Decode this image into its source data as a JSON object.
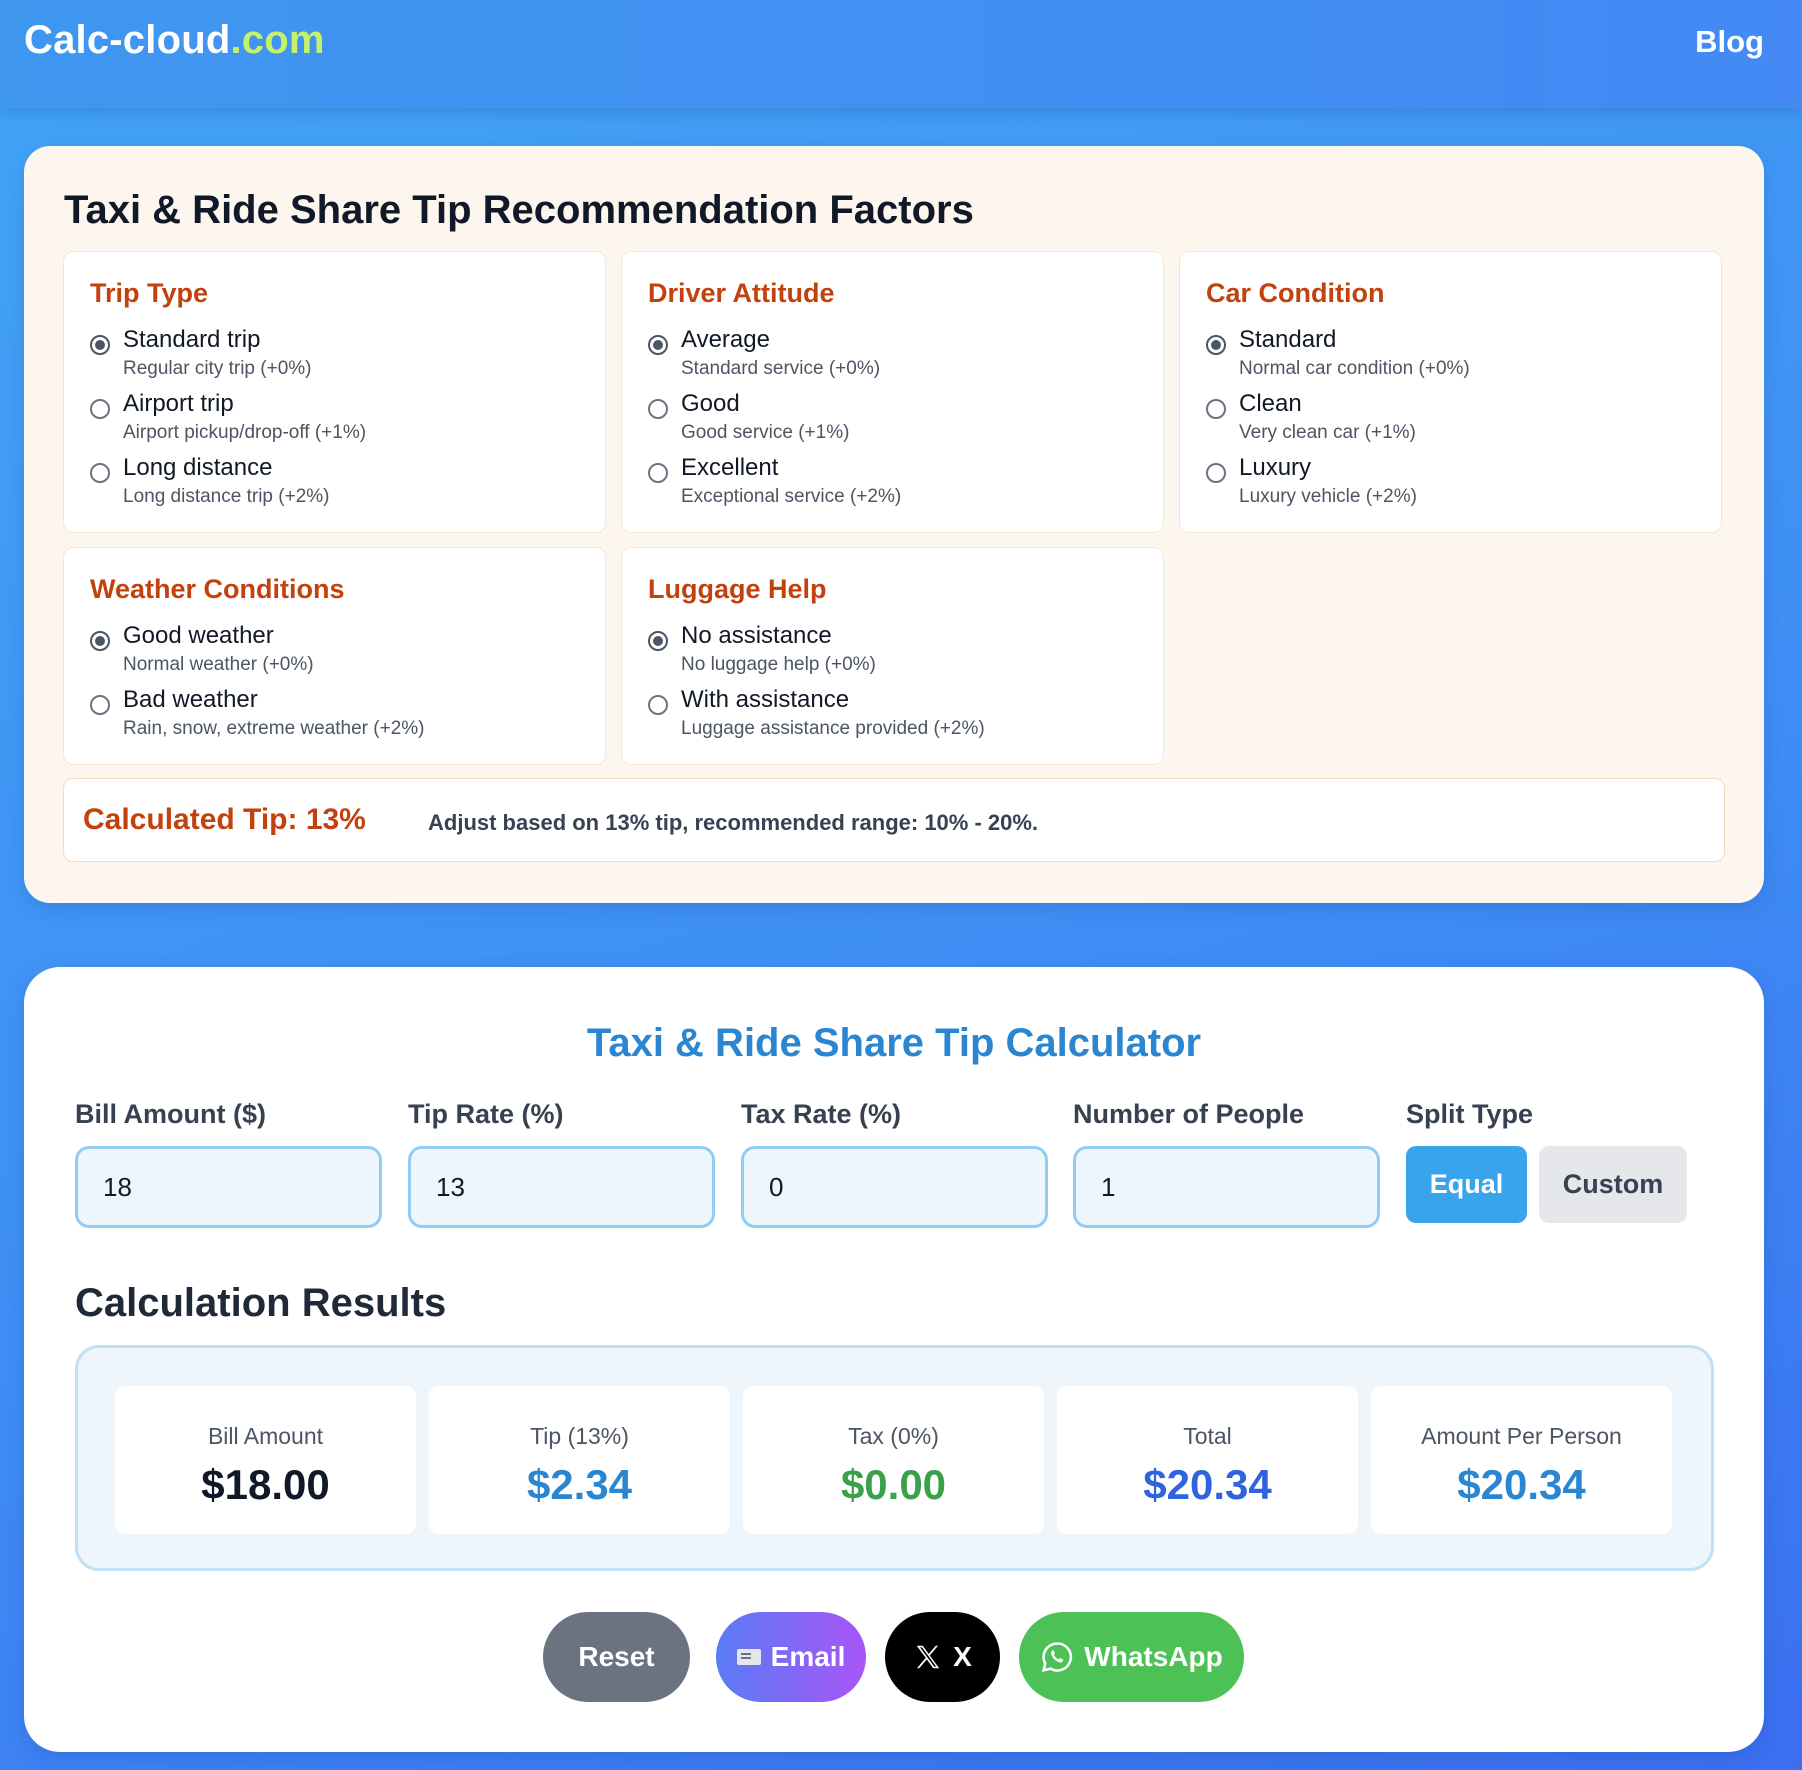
{
  "header": {
    "logo_main": "Calc-cloud",
    "logo_tld": ".com",
    "nav_blog": "Blog"
  },
  "factors": {
    "title": "Taxi & Ride Share Tip Recommendation Factors",
    "groups": [
      {
        "title": "Trip Type",
        "options": [
          {
            "label": "Standard trip",
            "desc": "Regular city trip (+0%)",
            "selected": true
          },
          {
            "label": "Airport trip",
            "desc": "Airport pickup/drop-off (+1%)",
            "selected": false
          },
          {
            "label": "Long distance",
            "desc": "Long distance trip (+2%)",
            "selected": false
          }
        ]
      },
      {
        "title": "Driver Attitude",
        "options": [
          {
            "label": "Average",
            "desc": "Standard service (+0%)",
            "selected": true
          },
          {
            "label": "Good",
            "desc": "Good service (+1%)",
            "selected": false
          },
          {
            "label": "Excellent",
            "desc": "Exceptional service (+2%)",
            "selected": false
          }
        ]
      },
      {
        "title": "Car Condition",
        "options": [
          {
            "label": "Standard",
            "desc": "Normal car condition (+0%)",
            "selected": true
          },
          {
            "label": "Clean",
            "desc": "Very clean car (+1%)",
            "selected": false
          },
          {
            "label": "Luxury",
            "desc": "Luxury vehicle (+2%)",
            "selected": false
          }
        ]
      },
      {
        "title": "Weather Conditions",
        "options": [
          {
            "label": "Good weather",
            "desc": "Normal weather (+0%)",
            "selected": true
          },
          {
            "label": "Bad weather",
            "desc": "Rain, snow, extreme weather (+2%)",
            "selected": false
          }
        ]
      },
      {
        "title": "Luggage Help",
        "options": [
          {
            "label": "No assistance",
            "desc": "No luggage help (+0%)",
            "selected": true
          },
          {
            "label": "With assistance",
            "desc": "Luggage assistance provided (+2%)",
            "selected": false
          }
        ]
      }
    ],
    "calculated_tip_label": "Calculated Tip: 13%",
    "calculated_tip_note": "Adjust based on 13% tip, recommended range: 10% - 20%."
  },
  "calculator": {
    "title": "Taxi & Ride Share Tip Calculator",
    "fields": {
      "bill_amount": {
        "label": "Bill Amount ($)",
        "value": "18"
      },
      "tip_rate": {
        "label": "Tip Rate (%)",
        "value": "13"
      },
      "tax_rate": {
        "label": "Tax Rate (%)",
        "value": "0"
      },
      "people": {
        "label": "Number of People",
        "value": "1"
      }
    },
    "split_type": {
      "label": "Split Type",
      "options": [
        "Equal",
        "Custom"
      ],
      "selected": "Equal"
    },
    "results": {
      "heading": "Calculation Results",
      "items": [
        {
          "label": "Bill Amount",
          "value": "$18.00"
        },
        {
          "label": "Tip (13%)",
          "value": "$2.34"
        },
        {
          "label": "Tax (0%)",
          "value": "$0.00"
        },
        {
          "label": "Total",
          "value": "$20.34"
        },
        {
          "label": "Amount Per Person",
          "value": "$20.34"
        }
      ]
    },
    "actions": {
      "reset": "Reset",
      "email": "Email",
      "x": "X",
      "whatsapp": "WhatsApp"
    }
  },
  "colors": {
    "accent_blue": "#38a4ec",
    "heading_orange": "#c2410c",
    "tip_value": "#2a86d0",
    "tax_value": "#3ba04a",
    "total_value": "#2f63e0",
    "whatsapp_green": "#4cc256"
  },
  "icons": {
    "email": "envelope-icon",
    "x": "x-logo-icon",
    "whatsapp": "whatsapp-icon",
    "radio_selected": "radio-checked",
    "radio_unselected": "radio-unchecked"
  }
}
